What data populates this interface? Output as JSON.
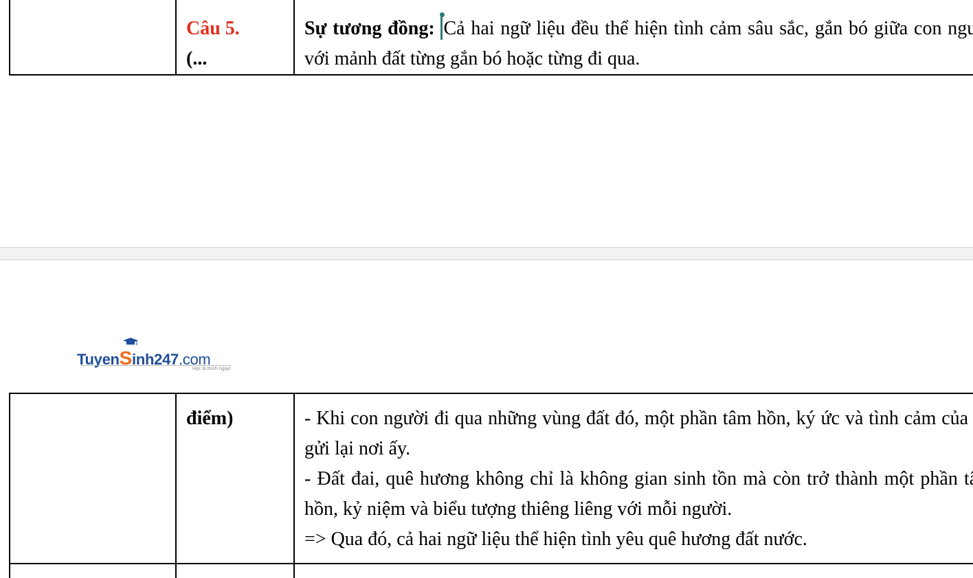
{
  "top_table": {
    "label_number": "Câu 5.",
    "label_continuation": "(...",
    "content_heading": "Sự tương đồng:",
    "content_text": "Cả hai ngữ liệu đều thể hiện tình cảm sâu sắc, gắn bó giữa con người với mảnh đất từng gắn bó hoặc từng đi qua."
  },
  "logo": {
    "part1": "Tuyen",
    "part2": "S",
    "part3": "inh247",
    "part4": ".com",
    "tagline": "Học là thích ngay!"
  },
  "bottom_table": {
    "label": "điểm)",
    "lines": [
      "- Khi con người đi qua những vùng đất đó, một phần tâm hồn, ký ức và tình cảm của họ gửi lại nơi ấy.",
      "- Đất đai, quê hương không chỉ là không gian sinh tồn mà còn trở thành một phần tâm hồn, kỷ niệm và biểu tượng thiêng liêng với mỗi người.",
      "=> Qua đó, cả hai ngữ liệu thể hiện tình yêu quê hương đất nước."
    ]
  },
  "colors": {
    "question_red": "#e0301e",
    "cursor_teal": "#2b7a78",
    "logo_blue": "#1f4e9a",
    "logo_orange": "#ee6c1a"
  },
  "icons": {
    "text_cursor": "text-cursor-icon",
    "logo_cap": "graduation-cap-icon"
  }
}
